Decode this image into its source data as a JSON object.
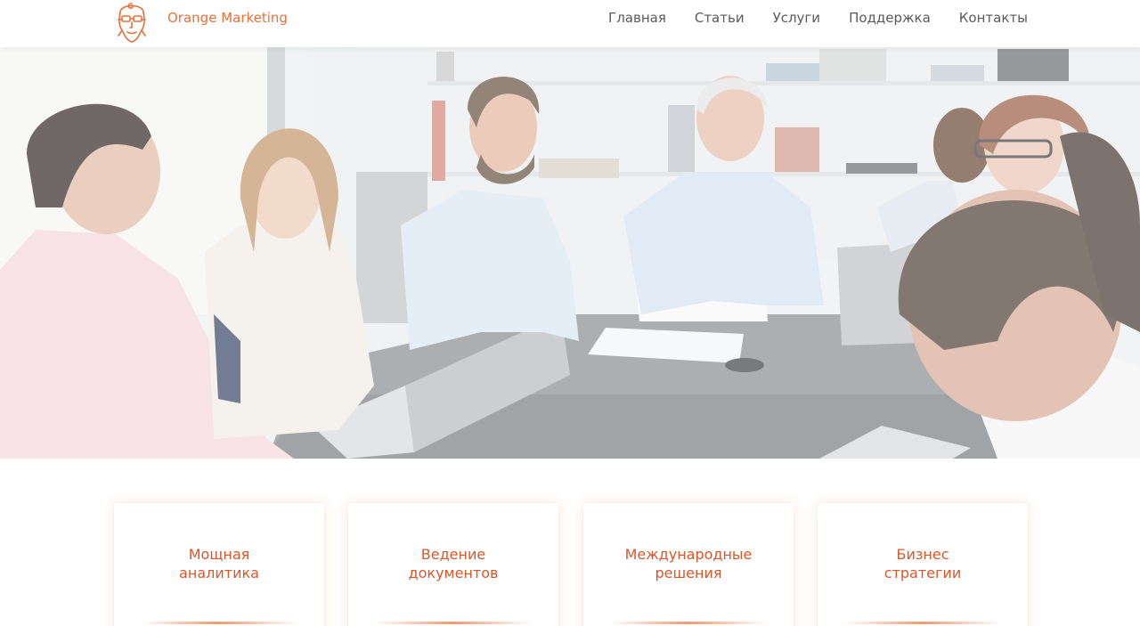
{
  "header": {
    "brand": "Orange Marketing",
    "logo_icon": "head-spiral-logo-icon",
    "nav": [
      {
        "label": "Главная"
      },
      {
        "label": "Статьи"
      },
      {
        "label": "Услуги"
      },
      {
        "label": "Поддержка"
      },
      {
        "label": "Контакты"
      }
    ]
  },
  "hero": {
    "image_description_icon": "team-meeting-photo"
  },
  "features": [
    {
      "title": "Мощная\nаналитика"
    },
    {
      "title": "Ведение\nдокументов"
    },
    {
      "title": "Международные\nрешения"
    },
    {
      "title": "Бизнес\nстратегии"
    }
  ],
  "colors": {
    "accent": "#e8703a",
    "accent_dark": "#d9572a",
    "nav_text": "#5a5a5a"
  }
}
